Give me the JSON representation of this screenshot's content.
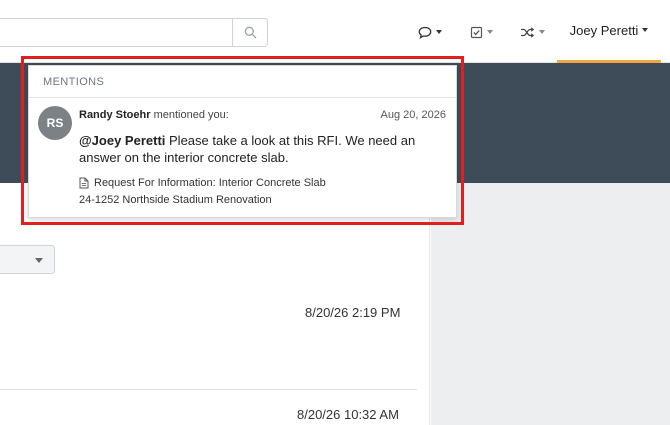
{
  "header": {
    "search": {
      "value": "",
      "placeholder": ""
    },
    "icons": {
      "search": "search-icon",
      "comment": "comment-icon",
      "tasks": "checkbox-icon",
      "shuffle": "shuffle-icon"
    },
    "user_name": "Joey Peretti"
  },
  "mentions": {
    "title": "MENTIONS",
    "item": {
      "avatar_initials": "RS",
      "author": "Randy Stoehr",
      "action": "mentioned you:",
      "date": "Aug 20, 2026",
      "mention_tag": "@Joey Peretti",
      "message": "Please take a look at this RFI.  We need an answer on the interior concrete slab.",
      "link_icon": "document-icon",
      "link_text": "Request For Information: Interior Concrete Slab",
      "project": "24-1252 Northside Stadium Renovation"
    }
  },
  "feed": {
    "timestamps": [
      "8/20/26 2:19 PM",
      "8/20/26 10:32 AM"
    ]
  },
  "colors": {
    "dark_band": "#3e4b58",
    "accent": "#f0a843",
    "highlight": "#e0201f",
    "avatar": "#7c8185"
  }
}
